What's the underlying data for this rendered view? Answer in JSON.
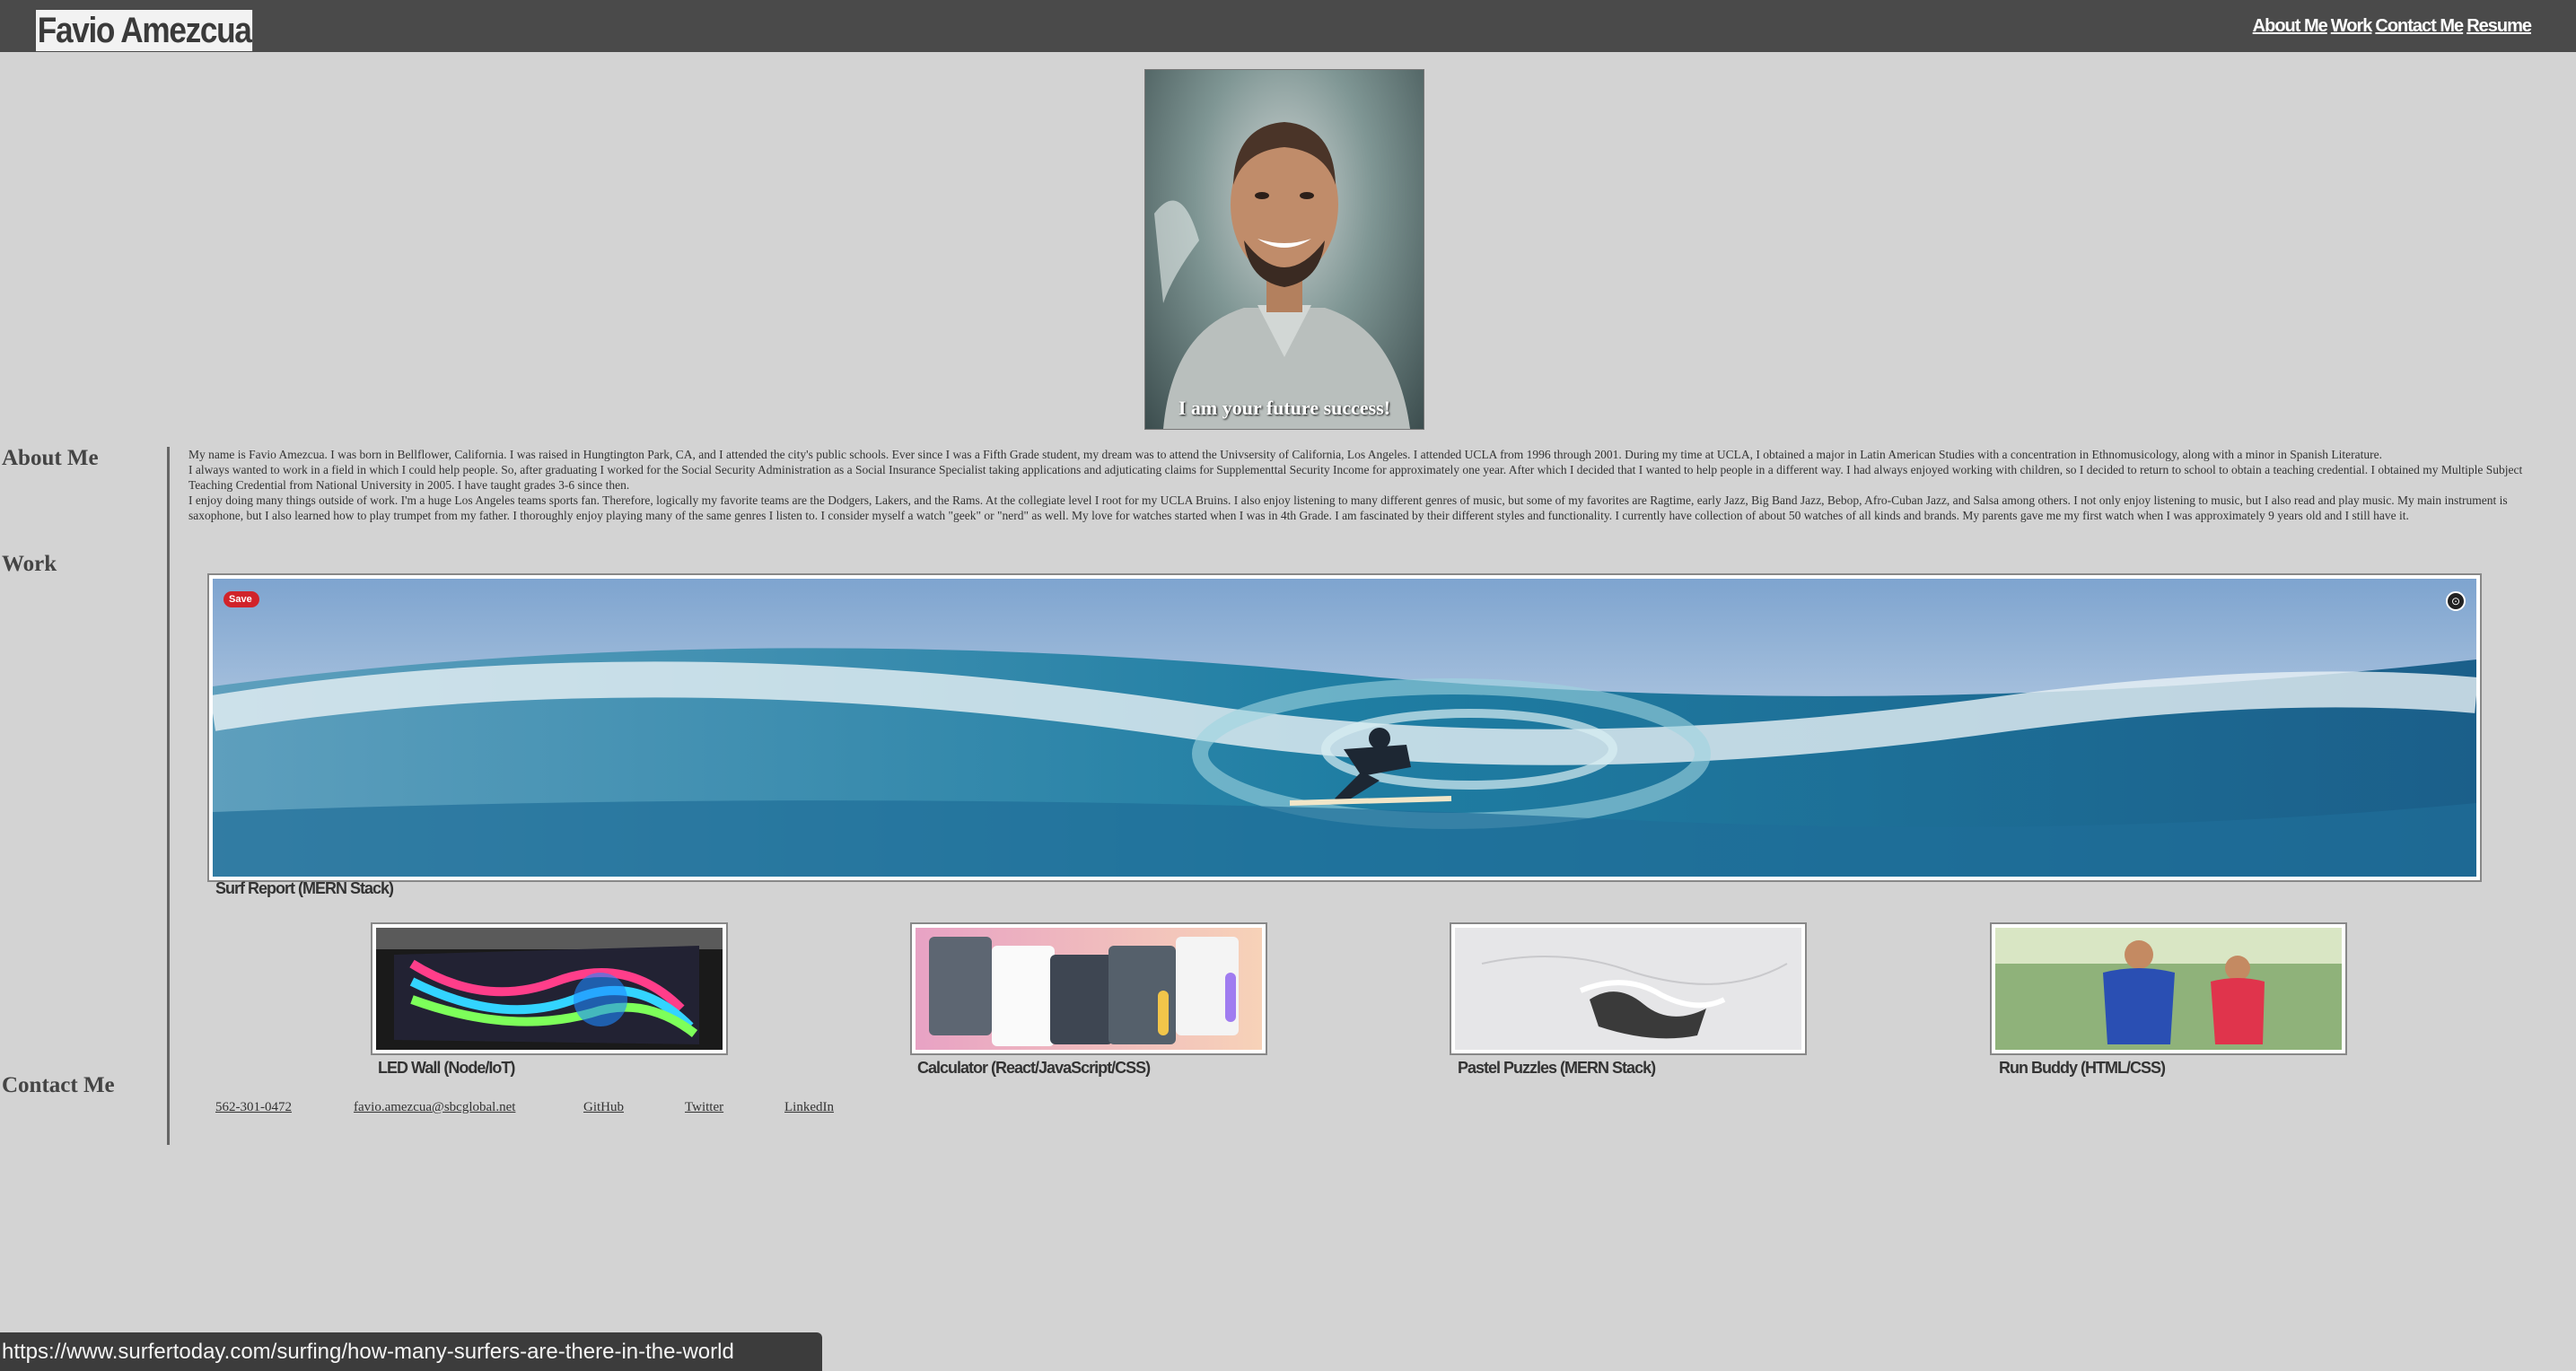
{
  "header": {
    "brand": "Favio Amezcua",
    "nav": [
      "About Me",
      "Work",
      "Contact Me",
      "Resume"
    ]
  },
  "portrait": {
    "caption": "I am your future success!"
  },
  "sections": {
    "about": "About Me",
    "work": "Work",
    "contact": "Contact Me"
  },
  "about": {
    "paragraphs": [
      "My name is Favio Amezcua. I was born in Bellflower, California. I was raised in Hungtington Park, CA, and I attended the city's public schools. Ever since I was a Fifth Grade student, my dream was to attend the Univsersity of California, Los Angeles. I attended UCLA from 1996 through 2001. During my time at UCLA, I obtained a major in Latin American Studies with a concentration in Ethnomusicology, along with a minor in Spanish Literature.",
      "I always wanted to work in a field in which I could help people. So, after graduating I worked for the Social Security Administration as a Social Insurance Specialist taking applications and adjuticating claims for Supplementtal Security Income for approximately one year. After which I decided that I wanted to help people in a different way. I had always enjoyed working with children, so I decided to return to school to obtain a teaching credential. I obtained my Multiple Subject Teaching Credential from National University in 2005. I have taught grades 3-6 since then.",
      "I enjoy doing many things outside of work. I'm a huge Los Angeles teams sports fan. Therefore, logically my favorite teams are the Dodgers, Lakers, and the Rams. At the collegiate level I root for my UCLA Bruins. I also enjoy listening to many different genres of music, but some of my favorites are Ragtime, early Jazz, Big Band Jazz, Bebop, Afro-Cuban Jazz, and Salsa among others. I not only enjoy listening to music, but I also read and play music. My main instrument is saxophone, but I also learned how to play trumpet from my father. I thoroughly enjoy playing many of the same genres I listen to. I consider myself a watch \"geek\" or \"nerd\" as well. My love for watches started when I was in 4th Grade. I am fascinated by their different styles and functionality. I currently have collection of about 50 watches of all kinds and brands. My parents gave me my first watch when I was approximately 9 years old and I still have it."
    ]
  },
  "work": {
    "featured": {
      "title": "Surf Report (MERN Stack)",
      "save_label": "Save"
    },
    "projects": [
      {
        "title": "LED Wall (Node/IoT)"
      },
      {
        "title": "Calculator (React/JavaScript/CSS)"
      },
      {
        "title": "Pastel Puzzles (MERN Stack)"
      },
      {
        "title": "Run Buddy (HTML/CSS)"
      }
    ]
  },
  "contact": {
    "links": [
      "562-301-0472",
      "favio.amezcua@sbcglobal.net",
      "GitHub",
      "Twitter",
      "LinkedIn"
    ]
  },
  "status_url": "https://www.surfertoday.com/surfing/how-many-surfers-are-there-in-the-world"
}
